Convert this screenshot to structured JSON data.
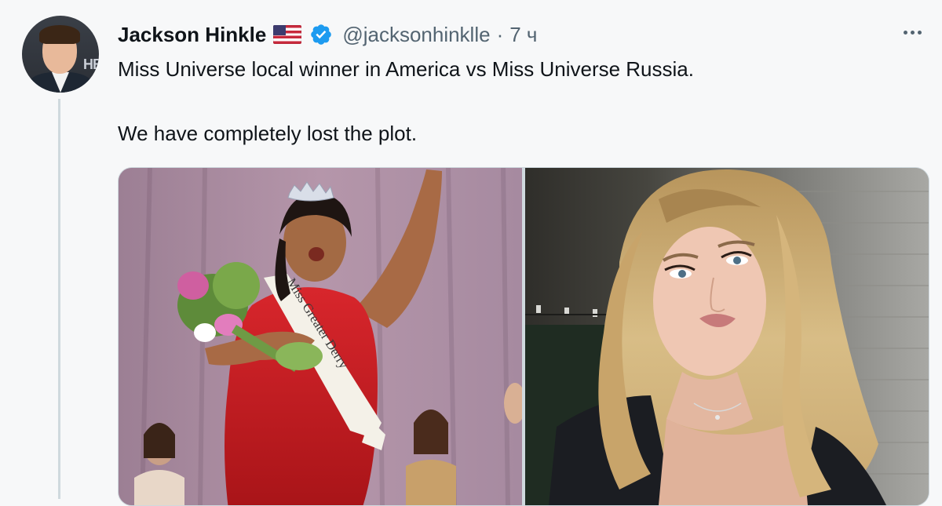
{
  "tweet": {
    "author_name": "Jackson Hinkle",
    "author_handle": "@jacksonhinklle",
    "time_separator": "·",
    "time_ago": "7 ч",
    "flag_icon": "us-flag-icon",
    "verified_icon": "verified-badge-icon",
    "verified_color": "#1d9bf0",
    "avatar_logo_text": "HB",
    "text_line1": "Miss Universe local winner in America vs Miss Universe Russia.",
    "text_line2": "We have completely lost the plot.",
    "more_icon": "more-options-icon",
    "media": [
      {
        "description_icon": "photo",
        "sash_text": "Miss Greater Derry"
      },
      {
        "description_icon": "photo"
      }
    ]
  },
  "colors": {
    "text_primary": "#0f1419",
    "text_secondary": "#536471",
    "background": "#f7f8f9",
    "thread_line": "#cfd9de"
  }
}
